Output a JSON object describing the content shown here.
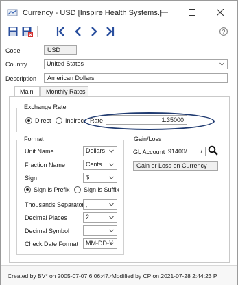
{
  "window": {
    "title": "Currency - USD [Inspire Health Systems.]",
    "app_icon": "currency-app-icon",
    "controls": [
      "minimize-icon",
      "maximize-icon",
      "close-icon"
    ]
  },
  "toolbar": {
    "icons": [
      "save-icon",
      "save-close-icon",
      "first-record-icon",
      "previous-record-icon",
      "next-record-icon",
      "last-record-icon",
      "help-icon"
    ],
    "help_label": "?"
  },
  "header": {
    "code_label": "Code",
    "code_value": "USD",
    "country_label": "Country",
    "country_value": "United States",
    "description_label": "Description",
    "description_value": "American Dollars"
  },
  "tabs": [
    {
      "label": "Main",
      "active": true
    },
    {
      "label": "Monthly Rates",
      "active": false
    }
  ],
  "exchange_rate": {
    "title": "Exchange Rate",
    "direct_label": "Direct",
    "indirect_label": "Indirect",
    "selected": "Direct",
    "rate_label": "Rate",
    "rate_value": "1.35000"
  },
  "format": {
    "title": "Format",
    "unit_name_label": "Unit Name",
    "unit_name_value": "Dollars",
    "fraction_name_label": "Fraction Name",
    "fraction_name_value": "Cents",
    "sign_label": "Sign",
    "sign_value": "$",
    "sign_prefix_label": "Sign is Prefix",
    "sign_suffix_label": "Sign is Suffix",
    "sign_position_selected": "Sign is Prefix",
    "thousands_label": "Thousands Separator",
    "thousands_value": ",",
    "decimal_places_label": "Decimal Places",
    "decimal_places_value": "2",
    "decimal_symbol_label": "Decimal Symbol",
    "decimal_symbol_value": ".",
    "check_date_label": "Check Date Format",
    "check_date_value": "MM-DD-Y"
  },
  "gain_loss": {
    "title": "Gain/Loss",
    "gl_account_label": "GL Account",
    "gl_account_value": "91400/",
    "gl_account_suffix": "/",
    "gl_account_desc": "Gain or Loss on Currency"
  },
  "status": {
    "text": "Created by BV* on 2005-07-07 6:06:47 ̷ Modified by CP on 2021-07-28 2:44:23 P"
  },
  "colors": {
    "toolbar_icon": "#2a4f9e",
    "highlight_ellipse": "#1f3a70",
    "field_border": "#a6a6a6"
  }
}
